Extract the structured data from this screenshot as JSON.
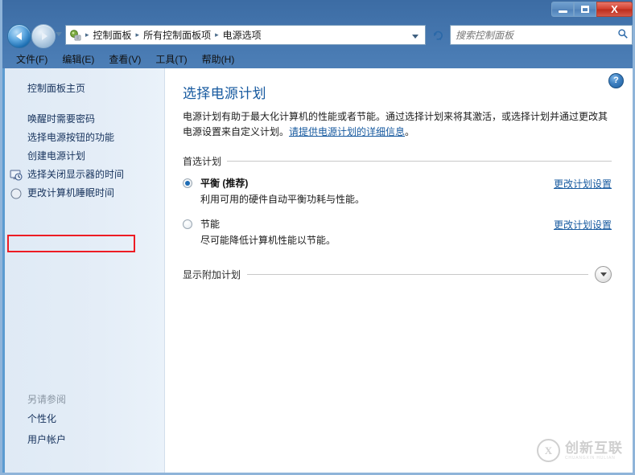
{
  "window": {
    "controls": {
      "minimize": "–",
      "maximize": "□",
      "close": "X"
    }
  },
  "nav": {
    "back_icon": "back-arrow-icon",
    "forward_icon": "forward-arrow-icon",
    "history_icon": "history-dropdown-icon",
    "breadcrumbs": [
      "控制面板",
      "所有控制面板项",
      "电源选项"
    ],
    "separator": "▸",
    "address_dropdown_icon": "chevron-down-icon",
    "refresh_icon": "↺",
    "search": {
      "placeholder": "搜索控制面板",
      "value": "",
      "icon": "⌕"
    }
  },
  "menubar": {
    "items": [
      "文件(F)",
      "编辑(E)",
      "查看(V)",
      "工具(T)",
      "帮助(H)"
    ]
  },
  "sidebar": {
    "home": "控制面板主页",
    "items": [
      {
        "label": "唤醒时需要密码",
        "icon": "none"
      },
      {
        "label": "选择电源按钮的功能",
        "icon": "none"
      },
      {
        "label": "创建电源计划",
        "icon": "none"
      },
      {
        "label": "选择关闭显示器的时间",
        "icon": "monitor-clock-icon",
        "highlighted": true
      },
      {
        "label": "更改计算机睡眠时间",
        "icon": "moon-sleep-icon"
      }
    ],
    "see_also": {
      "title": "另请参阅",
      "links": [
        "个性化",
        "用户帐户"
      ]
    }
  },
  "content": {
    "help_icon": "?",
    "title": "选择电源计划",
    "description_part1": "电源计划有助于最大化计算机的性能或者节能。通过选择计划来将其激活，或选择计划并通过更改其电源设置来自定义计划。",
    "description_link": "请提供电源计划的详细信息",
    "description_part2": "。",
    "preferred_group_label": "首选计划",
    "plans": [
      {
        "name": "平衡 (推荐)",
        "desc": "利用可用的硬件自动平衡功耗与性能。",
        "selected": true,
        "link": "更改计划设置"
      },
      {
        "name": "节能",
        "desc": "尽可能降低计算机性能以节能。",
        "selected": false,
        "link": "更改计划设置"
      }
    ],
    "additional_label": "显示附加计划",
    "expand_icon": "chevron-down-icon"
  },
  "watermark": {
    "mark": "X",
    "cn": "创新互联",
    "en": "CHUANGXIN HULIAN"
  },
  "colors": {
    "accent": "#16599f",
    "link": "#16599f",
    "highlight_box": "#ed1c24",
    "title_text": "#16599f",
    "sidebar_bg": "#e4edf7"
  }
}
